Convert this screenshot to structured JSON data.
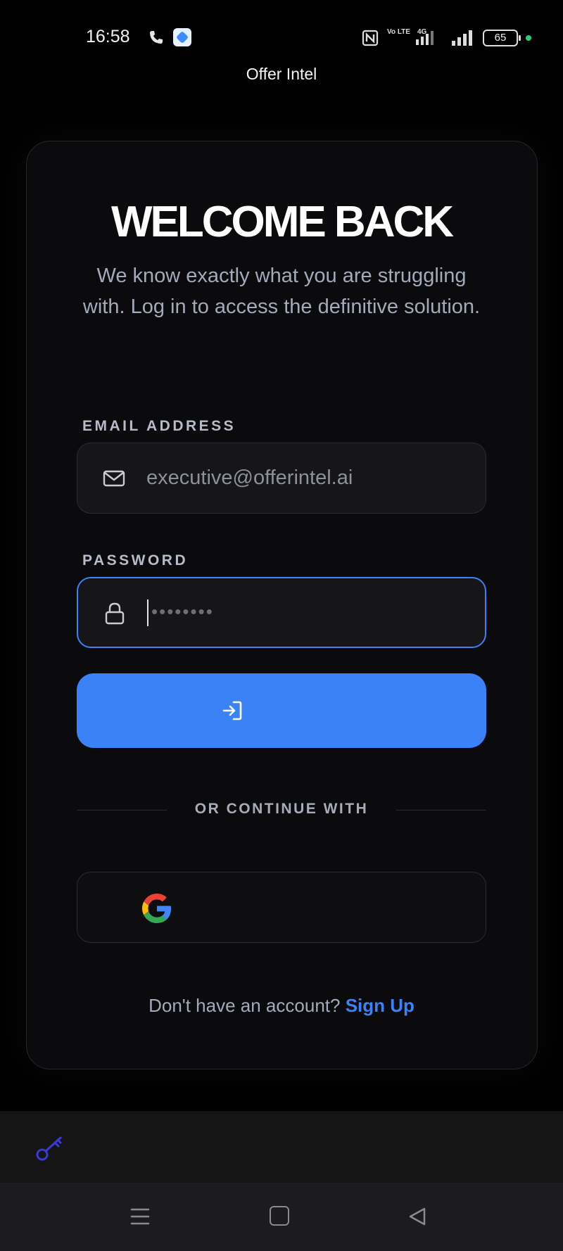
{
  "status_bar": {
    "time": "16:58",
    "icons": [
      "phone-call-icon",
      "app-notification-icon",
      "nfc-icon",
      "volte-icon",
      "signal-4g-icon",
      "signal-icon",
      "battery-icon"
    ],
    "volte_text": "Vo LTE",
    "network": "4G",
    "battery": "65",
    "battery_dot_color": "#2ecc71"
  },
  "app": {
    "title": "Offer Intel"
  },
  "login": {
    "heading": "WELCOME BACK",
    "subtitle": "We know exactly what you are struggling with. Log in to access the definitive solution.",
    "email_label": "EMAIL ADDRESS",
    "email_value": "executive@offerintel.ai",
    "email_icon": "mail-icon",
    "password_label": "PASSWORD",
    "password_value": "••••••••",
    "password_icon": "lock-icon",
    "submit_icon": "login-arrow-icon",
    "divider_text": "OR CONTINUE WITH",
    "google_icon": "google-icon",
    "signup_prompt": "Don't have an account?",
    "signup_link": "Sign Up"
  },
  "bottom_bar": {
    "icon": "key-icon",
    "icon_color": "#3a3ad8"
  },
  "nav_bar": {
    "icons": [
      "menu-icon",
      "home-icon",
      "back-icon"
    ]
  },
  "colors": {
    "accent": "#3b82f6",
    "background": "#000000",
    "card": "#0b0b0d",
    "muted_text": "#a3aabb"
  }
}
